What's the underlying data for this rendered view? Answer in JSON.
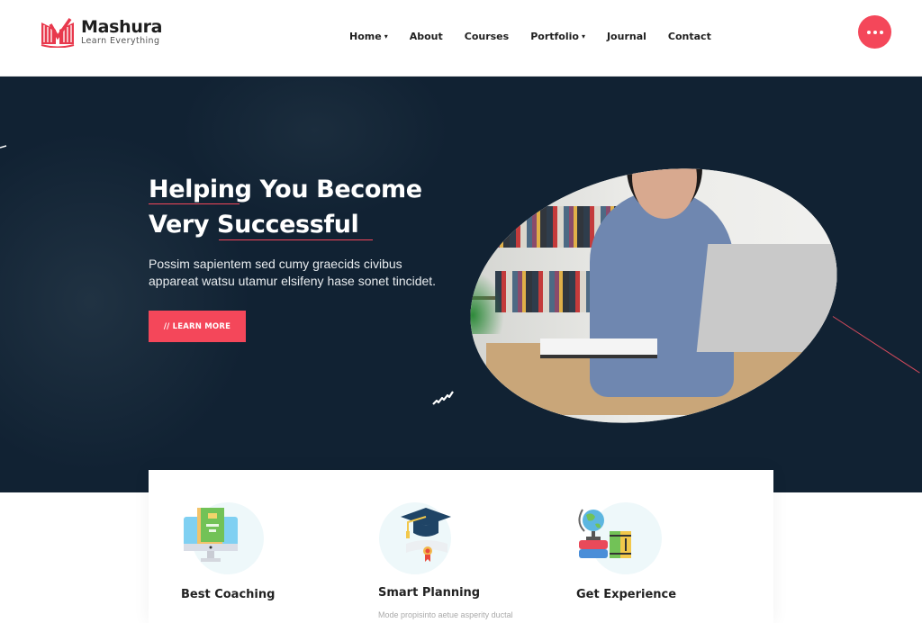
{
  "brand": {
    "name": "Mashura",
    "tagline": "Learn Everything",
    "accent": "#f4475a",
    "hero_bg": "#112233"
  },
  "nav": {
    "items": [
      {
        "label": "Home",
        "has_dropdown": true,
        "caret": "▾"
      },
      {
        "label": "About",
        "has_dropdown": false
      },
      {
        "label": "Courses",
        "has_dropdown": false
      },
      {
        "label": "Portfolio",
        "has_dropdown": true,
        "caret": "▾"
      },
      {
        "label": "Journal",
        "has_dropdown": false
      },
      {
        "label": "Contact",
        "has_dropdown": false
      }
    ],
    "more_icon": "ellipsis-icon"
  },
  "hero": {
    "title_line1": "Helping You Become",
    "title_line2": "Very Successful",
    "subtitle": "Possim sapientem sed cumy graecids civibus appareat watsu utamur elsifeny hase sonet tincidet.",
    "cta_label": "// LEARN MORE",
    "image_alt": "woman-with-headphones-studying-at-laptop"
  },
  "features": [
    {
      "title": "Best Coaching",
      "icon": "monitor-book-icon"
    },
    {
      "title": "Smart Planning",
      "icon": "graduation-cap-diploma-icon",
      "desc": "Mode propisinto aetue asperity ductal"
    },
    {
      "title": "Get Experience",
      "icon": "globe-books-icon"
    }
  ]
}
